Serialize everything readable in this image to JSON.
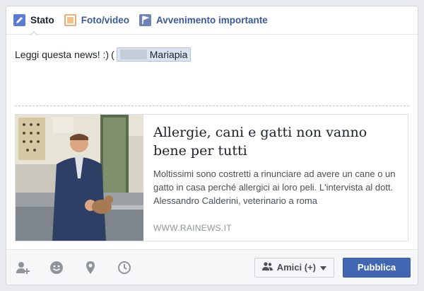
{
  "tabs": [
    {
      "label": "Stato",
      "icon": "pencil-icon"
    },
    {
      "label": "Foto/video",
      "icon": "photo-icon"
    },
    {
      "label": "Avvenimento importante",
      "icon": "flag-icon"
    }
  ],
  "status": {
    "text": "Leggi questa news! :)",
    "tag_prefix": "(",
    "tag_name": "Mariapia"
  },
  "link_card": {
    "title": "Allergie, cani e gatti non vanno bene per tutti",
    "description": "Moltissimi sono costretti a rinunciare ad avere un cane o un gatto in casa perché allergici ai loro peli. L'intervista al dott. Alessandro Calderini, veterinario a roma",
    "domain": "WWW.RAINEWS.IT"
  },
  "footer": {
    "icons": [
      "tag-friends-icon",
      "feeling-icon",
      "location-icon",
      "clock-icon"
    ],
    "audience_label": "Amici (+)",
    "publish_label": "Pubblica"
  },
  "colors": {
    "brand_blue": "#4267b2",
    "link_blue": "#3b5998"
  }
}
